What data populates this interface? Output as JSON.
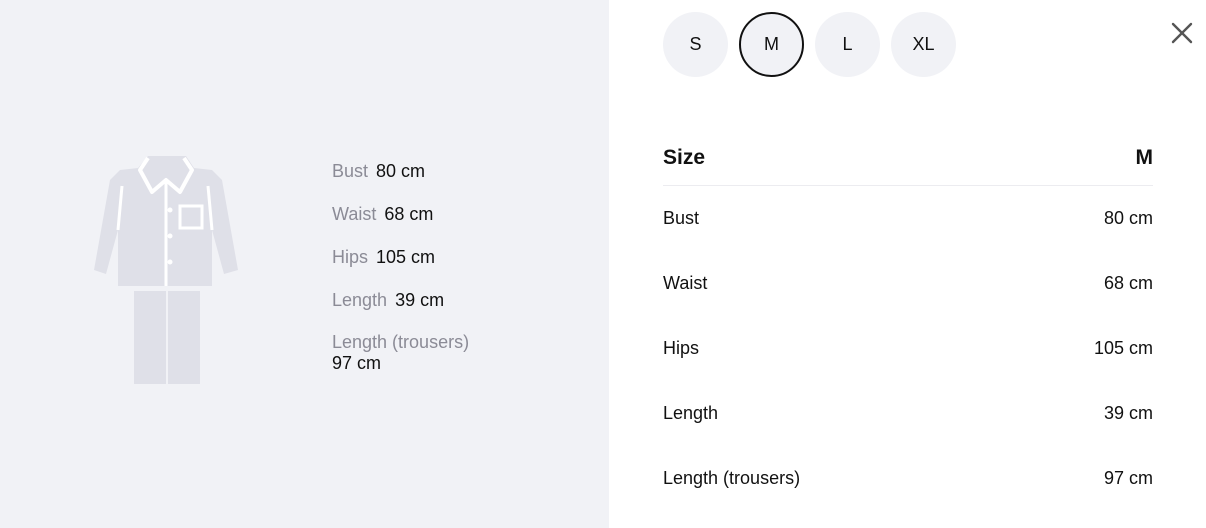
{
  "illustration": {
    "icon": "pajama-set-icon",
    "fill_color": "#dfe0e8"
  },
  "measurements": [
    {
      "label": "Bust",
      "value": "80 cm"
    },
    {
      "label": "Waist",
      "value": "68 cm"
    },
    {
      "label": "Hips",
      "value": "105 cm"
    },
    {
      "label": "Length",
      "value": "39 cm"
    },
    {
      "label": "Length (trousers)",
      "value": "97 cm"
    }
  ],
  "size_selector": {
    "options": [
      "S",
      "M",
      "L",
      "XL"
    ],
    "selected": "M"
  },
  "close_icon": "close-icon",
  "size_table": {
    "header": {
      "label": "Size",
      "value": "M"
    },
    "rows": [
      {
        "label": "Bust",
        "value": "80 cm"
      },
      {
        "label": "Waist",
        "value": "68 cm"
      },
      {
        "label": "Hips",
        "value": "105 cm"
      },
      {
        "label": "Length",
        "value": "39 cm"
      },
      {
        "label": "Length (trousers)",
        "value": "97 cm"
      }
    ]
  },
  "colors": {
    "panel_bg": "#f1f2f6",
    "muted_text": "#8b8b96",
    "text": "#111111"
  }
}
